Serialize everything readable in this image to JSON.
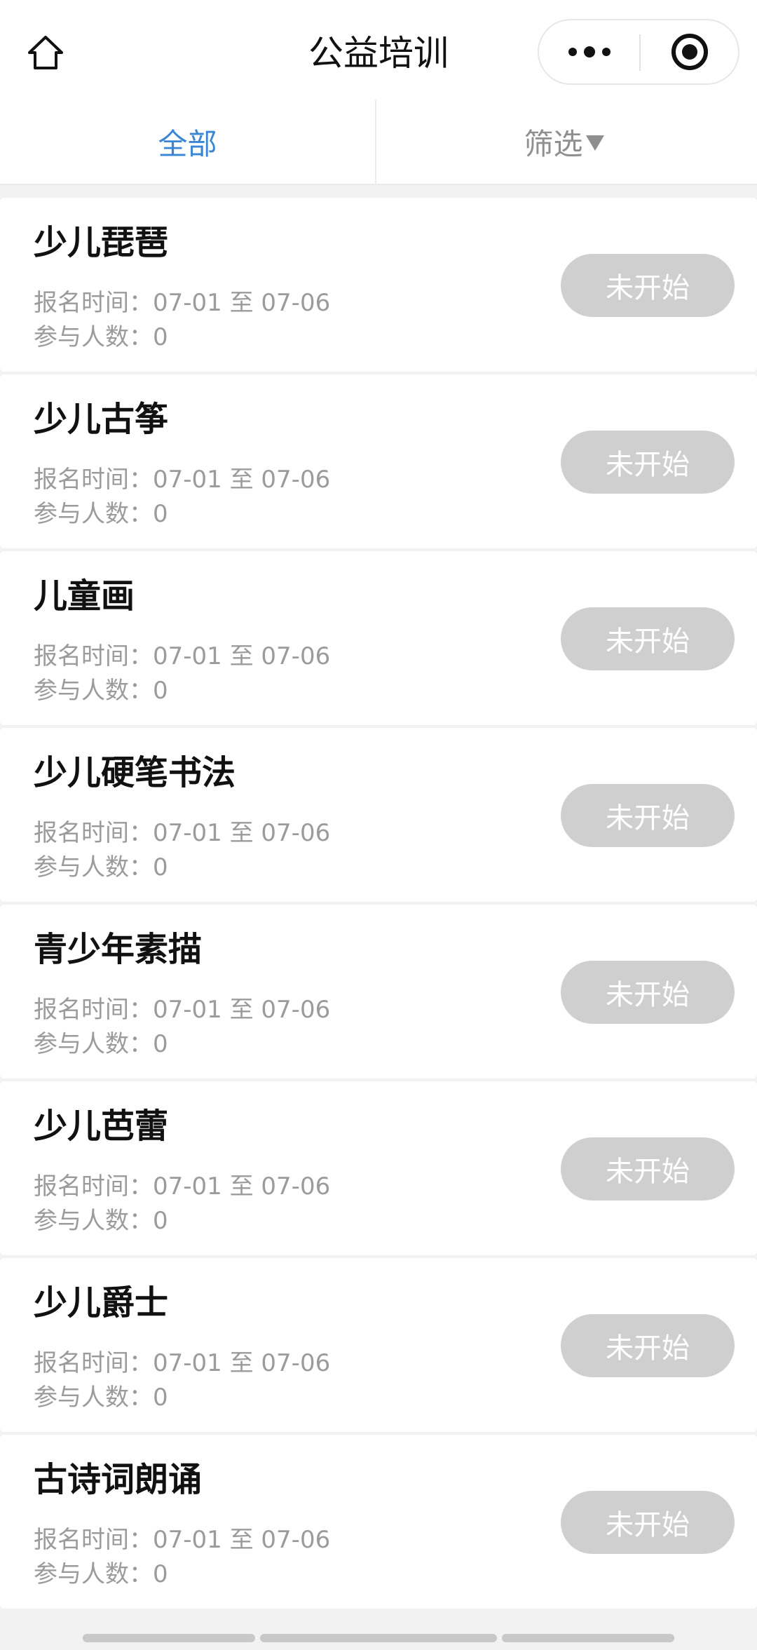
{
  "header": {
    "title": "公益培训",
    "home_icon": "home-icon",
    "more_icon": "more-icon",
    "close_icon": "target-close-icon"
  },
  "tabs": {
    "all_label": "全部",
    "filter_label": "筛选",
    "active_color": "#3a86d4",
    "inactive_color": "#8f8f8f"
  },
  "courses": [
    {
      "title": "少儿琵琶",
      "time": "报名时间：07-01 至 07-06",
      "count": "参与人数：0",
      "status": "未开始"
    },
    {
      "title": "少儿古筝",
      "time": "报名时间：07-01 至 07-06",
      "count": "参与人数：0",
      "status": "未开始"
    },
    {
      "title": "儿童画",
      "time": "报名时间：07-01 至 07-06",
      "count": "参与人数：0",
      "status": "未开始"
    },
    {
      "title": "少儿硬笔书法",
      "time": "报名时间：07-01 至 07-06",
      "count": "参与人数：0",
      "status": "未开始"
    },
    {
      "title": "青少年素描",
      "time": "报名时间：07-01 至 07-06",
      "count": "参与人数：0",
      "status": "未开始"
    },
    {
      "title": "少儿芭蕾",
      "time": "报名时间：07-01 至 07-06",
      "count": "参与人数：0",
      "status": "未开始"
    },
    {
      "title": "少儿爵士",
      "time": "报名时间：07-01 至 07-06",
      "count": "参与人数：0",
      "status": "未开始"
    },
    {
      "title": "古诗词朗诵",
      "time": "报名时间：07-01 至 07-06",
      "count": "参与人数：0",
      "status": "未开始"
    }
  ],
  "colors": {
    "status_button_bg": "#cfcfcf",
    "page_bg": "#f2f2f2"
  }
}
